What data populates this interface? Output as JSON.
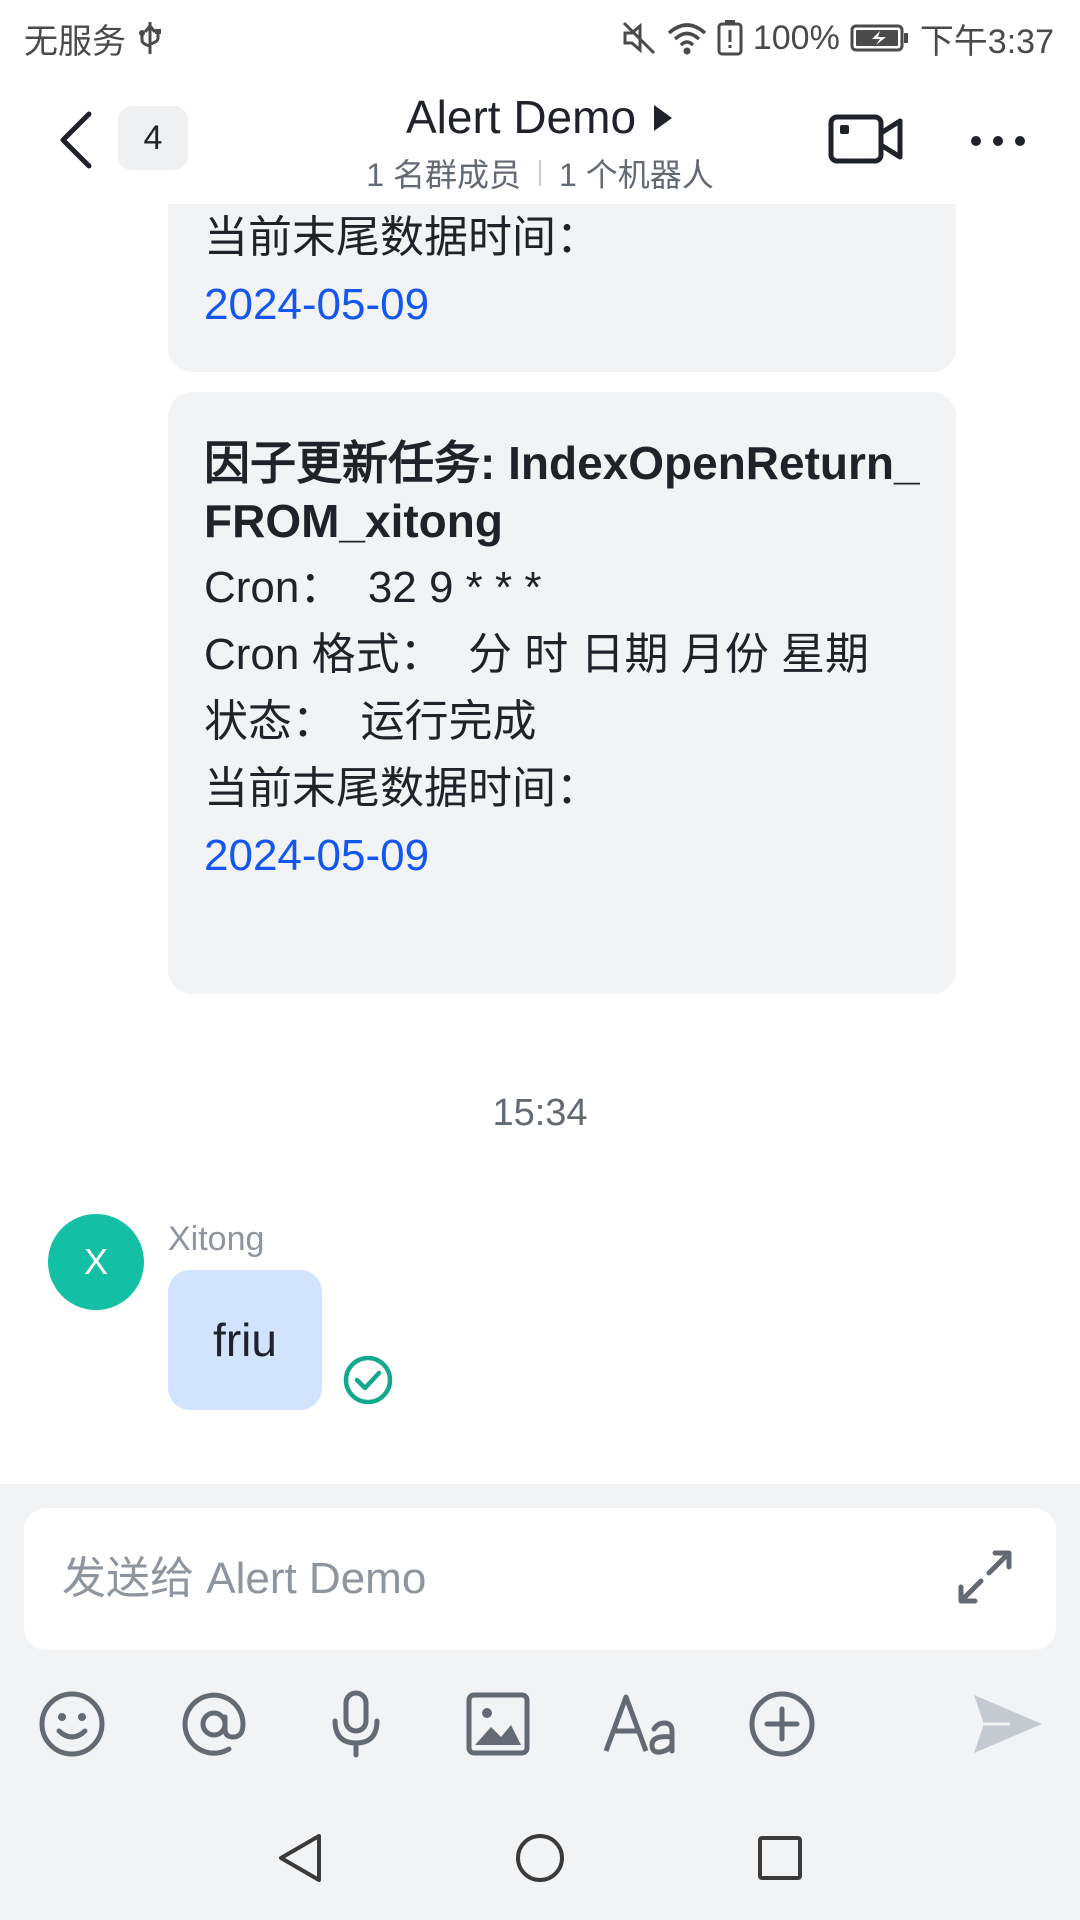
{
  "status_bar": {
    "carrier": "无服务",
    "battery": "100%",
    "time": "下午3:37",
    "icons": [
      "usb-icon",
      "mute-icon",
      "wifi-icon",
      "battery-alert-icon",
      "battery-icon"
    ]
  },
  "header": {
    "unread_count": "4",
    "title": "Alert Demo",
    "members": "1 名群成员",
    "bots": "1 个机器人",
    "icons": [
      "back-arrow-icon",
      "play-triangle-icon",
      "video-camera-icon",
      "more-dots-icon"
    ]
  },
  "messages": {
    "card1": {
      "label": "当前末尾数据时间：",
      "date": "2024-05-09"
    },
    "card2": {
      "title": "因子更新任务: IndexOpenReturn_FROM_xitong",
      "cron": "Cron：  32 9 * * *",
      "cron_format": "Cron 格式：  分 时 日期 月份 星期",
      "status": "状态：  运行完成",
      "label": "当前末尾数据时间：",
      "date": "2024-05-09"
    },
    "time_separator": "15:34",
    "user_message": {
      "avatar_letter": "X",
      "sender": "Xitong",
      "text": "friu"
    }
  },
  "composer": {
    "placeholder": "发送给 Alert Demo",
    "toolbar_icons": [
      "emoji-icon",
      "mention-icon",
      "microphone-icon",
      "image-icon",
      "text-format-icon",
      "plus-icon",
      "send-icon"
    ]
  },
  "colors": {
    "link": "#1456f0",
    "avatar": "#14c0a5",
    "my_bubble": "#d1e3ff",
    "card_bg": "#f2f3f5",
    "read_check": "#14a88c"
  }
}
